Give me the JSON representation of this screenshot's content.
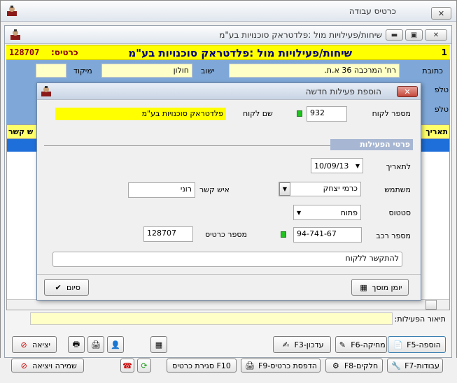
{
  "outer_window": {
    "title": "כרטיס עבודה"
  },
  "inner_window": {
    "title": "שיחות/פעילויות מול :פלדטראק סוכנויות בע\"מ"
  },
  "header_bar": {
    "index": "1",
    "title": "שיחות/פעילויות מול :פלדטראק סוכנויות בע\"מ",
    "card_label": "כרטיס:",
    "card_number": "128707"
  },
  "customer": {
    "address_label": "כתובת",
    "address_value": "רח' המרכבה 36 א.ת.",
    "city_label": "ישוב",
    "city_value": "חולון",
    "zip_label": "מיקוד",
    "zip_value": "",
    "phone_label": "טלפ"
  },
  "grid": {
    "col_date": "תאריך",
    "col_contact": "ש קשר"
  },
  "activity_desc": {
    "label": "תיאור הפעילות:",
    "value": ""
  },
  "dialog": {
    "title": "הוספת פעילות חדשה",
    "customer_number_label": "מספר לקוח",
    "customer_number": "932",
    "customer_name_label": "שם לקוח",
    "customer_name": "פלדטראק סוכנויות בע\"מ",
    "section_title": "פרטי הפעילות",
    "date_label": "לתאריך",
    "date_value": "10/09/13",
    "user_label": "משתמש",
    "user_value": "כרמי יצחק",
    "contact_label": "איש קשר",
    "contact_value": "רוני",
    "status_label": "סטטוס",
    "status_value": "פתוח",
    "vehicle_label": "מספר רכב",
    "vehicle_value": "94-741-67",
    "card_label": "מספר כרטיס",
    "card_value": "128707",
    "note_value": "להתקשר ללקוח",
    "calendar_button": "יומן מוסך",
    "finish_button": "סיום"
  },
  "toolbar": {
    "add": "F5-הוספה",
    "delete": "F6-מחיקה",
    "update": "F3-עדכון",
    "exit": "יציאה"
  },
  "bottom_bar": {
    "jobs": "F7-עבודות",
    "parts": "F8-חלקים",
    "print_card": "F9-הדפסת כרטיס",
    "close_card": "סגירת כרטיס F10",
    "save_exit": "שמירה ויציאה"
  },
  "colors": {
    "header_yellow": "#ffff00",
    "field_yellow": "#ffffc8",
    "blue_area": "#7fa8d8",
    "section_blue": "#a7b7d3",
    "grid_blue": "#1e6fd9"
  }
}
